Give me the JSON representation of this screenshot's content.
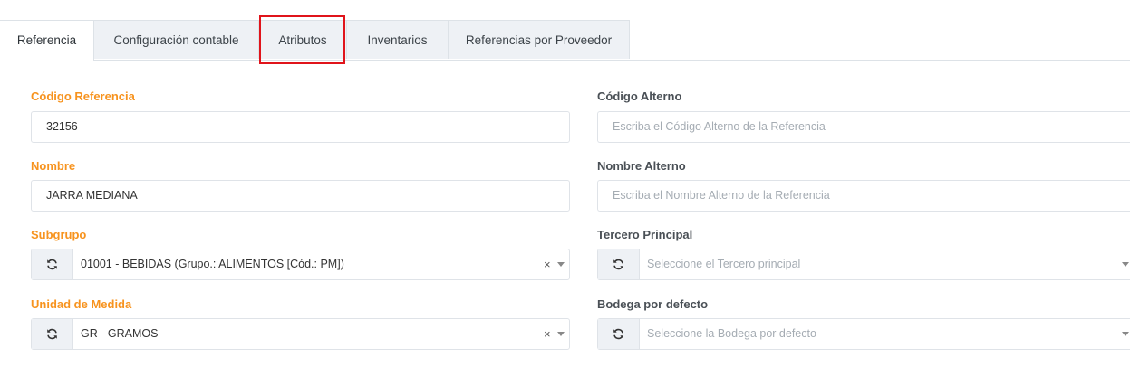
{
  "tabs": [
    {
      "label": "Referencia",
      "active": true
    },
    {
      "label": "Configuración contable",
      "active": false
    },
    {
      "label": "Atributos",
      "active": false
    },
    {
      "label": "Inventarios",
      "active": false
    },
    {
      "label": "Referencias por Proveedor",
      "active": false
    }
  ],
  "colors": {
    "required_label": "#f7931e",
    "highlight_box": "#e0141b"
  },
  "left": {
    "codigo_referencia": {
      "label": "Código Referencia",
      "value": "32156"
    },
    "nombre": {
      "label": "Nombre",
      "value": "JARRA MEDIANA"
    },
    "subgrupo": {
      "label": "Subgrupo",
      "value": "01001 - BEBIDAS (Grupo.: ALIMENTOS [Cód.: PM])",
      "clear": "×",
      "icon": "refresh-icon"
    },
    "unidad_medida": {
      "label": "Unidad de Medida",
      "value": "GR - GRAMOS",
      "clear": "×",
      "icon": "refresh-icon"
    }
  },
  "right": {
    "codigo_alterno": {
      "label": "Código Alterno",
      "placeholder": "Escriba el Código Alterno de la Referencia"
    },
    "nombre_alterno": {
      "label": "Nombre Alterno",
      "placeholder": "Escriba el Nombre Alterno de la Referencia"
    },
    "tercero_principal": {
      "label": "Tercero Principal",
      "placeholder": "Seleccione el Tercero principal",
      "icon": "refresh-icon"
    },
    "bodega_defecto": {
      "label": "Bodega por defecto",
      "placeholder": "Seleccione la Bodega por defecto",
      "icon": "refresh-icon"
    }
  }
}
